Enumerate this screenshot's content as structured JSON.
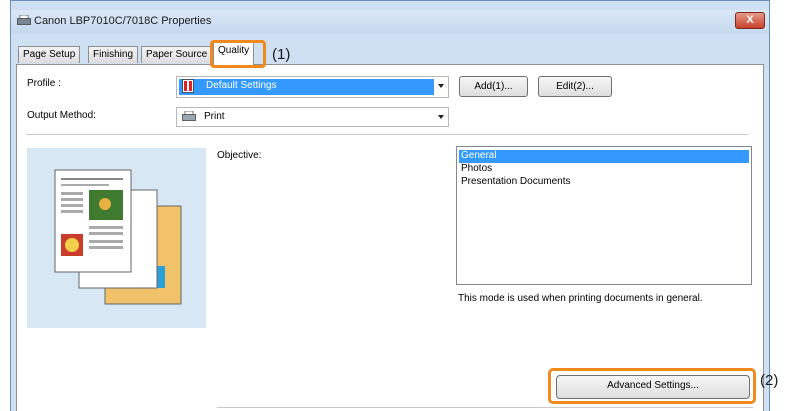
{
  "window": {
    "title": "Canon LBP7010C/7018C Properties",
    "close_label": "X"
  },
  "tabs": [
    {
      "label": "Page Setup"
    },
    {
      "label": "Finishing"
    },
    {
      "label": "Paper Source"
    },
    {
      "label": "Quality"
    }
  ],
  "callouts": {
    "first": "(1)",
    "second": "(2)"
  },
  "profile": {
    "label": "Profile :",
    "value": "Default Settings",
    "add_label": "Add(1)...",
    "edit_label": "Edit(2)..."
  },
  "output_method": {
    "label": "Output Method:",
    "value": "Print"
  },
  "objective": {
    "label": "Objective:",
    "options": [
      "General",
      "Photos",
      "Presentation Documents"
    ],
    "selected": "General",
    "description": "This mode is used when printing documents in general."
  },
  "advanced_label": "Advanced Settings...",
  "colors": {
    "highlight": "#f08a1e",
    "selection": "#3399ff"
  }
}
